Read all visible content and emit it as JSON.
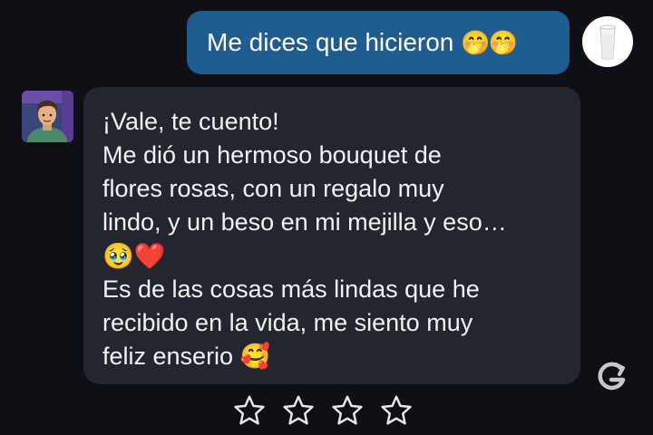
{
  "user_message": {
    "text": "Me dices que hicieron",
    "emoji": "🤭🤭"
  },
  "bot_message": {
    "lines": [
      "¡Vale, te cuento!",
      "Me dió un hermoso bouquet de",
      "flores rosas, con un regalo muy",
      "lindo, y un beso en mi mejilla y eso…",
      "🥹❤️",
      "Es de las cosas más lindas que he",
      "recibido en la vida, me siento muy",
      "feliz enserio  🥰"
    ]
  },
  "icons": {
    "user_avatar": "milk-glass-avatar",
    "bot_avatar": "character-avatar",
    "regenerate": "regenerate-icon",
    "rating": "star-icon"
  },
  "rating": {
    "stars_total": 4,
    "stars_filled": 0
  },
  "colors": {
    "background": "#0e1015",
    "user_bubble": "#1f5d91",
    "bot_bubble": "#23262e",
    "text": "#f2f2f2"
  }
}
